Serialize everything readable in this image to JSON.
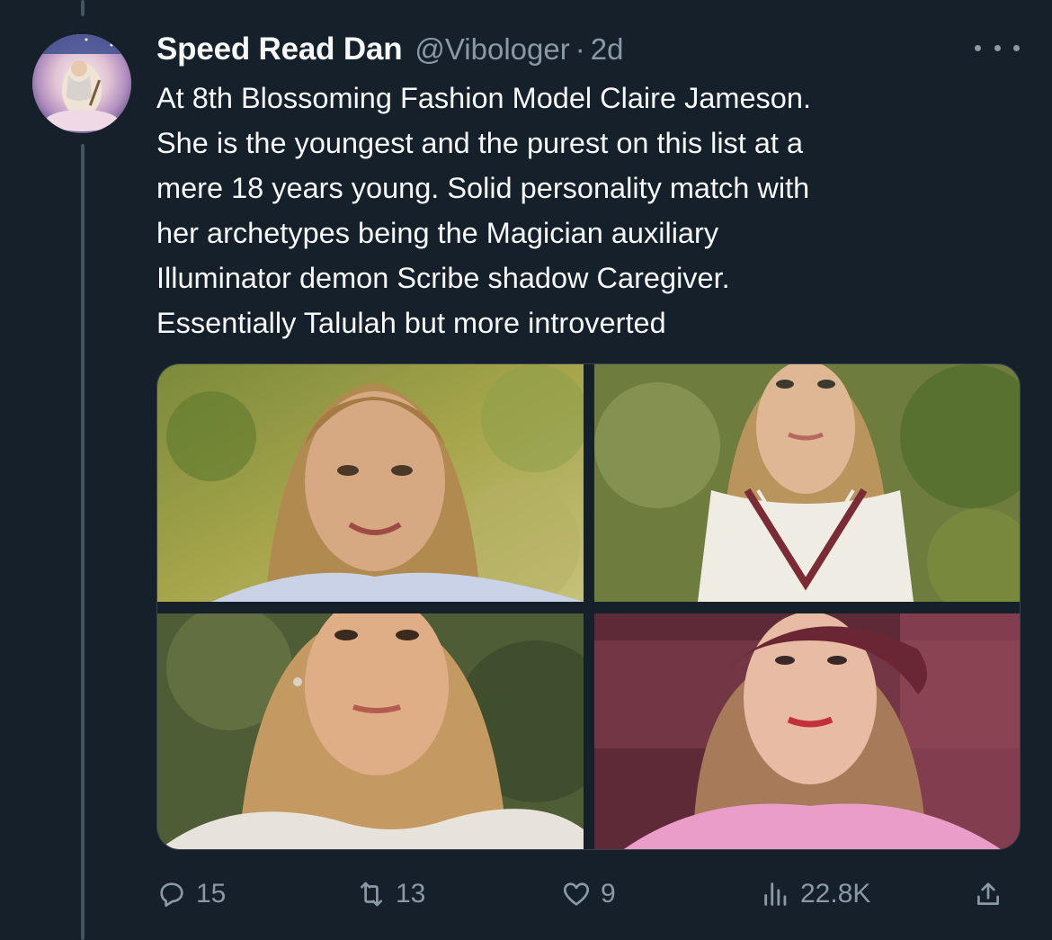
{
  "author": {
    "display_name": "Speed Read Dan",
    "handle": "@Vibologer",
    "separator": "·",
    "time": "2d"
  },
  "tweet": {
    "text_lines": [
      "At 8th Blossoming Fashion Model Claire Jameson.",
      "She is the youngest and the purest on this list at a",
      "mere 18 years young. Solid personality match with",
      "her archetypes being the Magician auxiliary",
      "Illuminator demon Scribe shadow Caregiver.",
      "Essentially Talulah but more introverted"
    ]
  },
  "media": {
    "count": 4,
    "photos": [
      {
        "name": "photo-1",
        "description": "woman with wavy blonde hair smiling outdoors"
      },
      {
        "name": "photo-2",
        "description": "woman in white v-neck top outdoors"
      },
      {
        "name": "photo-3",
        "description": "woman with long blonde hair and earrings"
      },
      {
        "name": "photo-4",
        "description": "woman in burgundy beret and pink top"
      }
    ]
  },
  "actions": {
    "replies": "15",
    "retweets": "13",
    "likes": "9",
    "views": "22.8K"
  },
  "icons": {
    "reply": "reply-icon",
    "retweet": "retweet-icon",
    "like": "heart-icon",
    "views": "views-icon",
    "share": "share-icon",
    "more": "more-icon"
  },
  "colors": {
    "background": "#15202b",
    "text_primary": "#f7f9f9",
    "text_secondary": "#8b98a5",
    "thread_line": "#425364"
  }
}
